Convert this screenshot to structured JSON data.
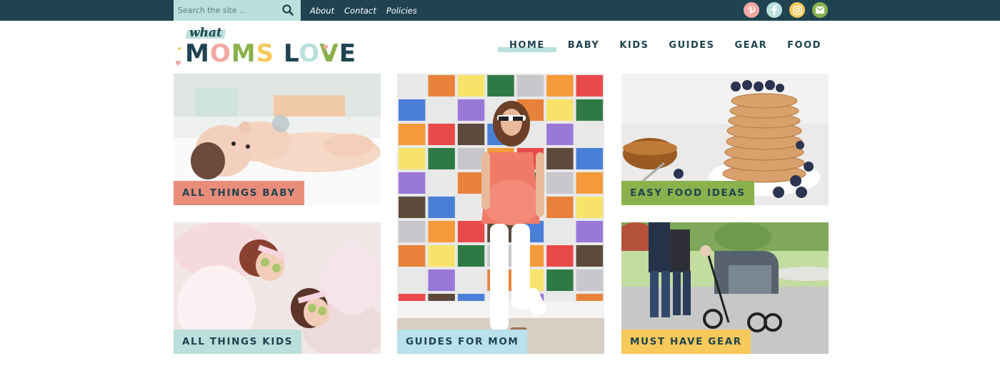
{
  "topbar": {
    "search_placeholder": "Search the site ...",
    "links": [
      "About",
      "Contact",
      "Policies"
    ],
    "social": [
      {
        "name": "pinterest-icon",
        "color": "#f2a7a0"
      },
      {
        "name": "facebook-icon",
        "color": "#b9e0db"
      },
      {
        "name": "instagram-icon",
        "color": "#f7c95a"
      },
      {
        "name": "email-icon",
        "color": "#8bb14c"
      }
    ]
  },
  "logo": {
    "top_word": "what",
    "letters": [
      {
        "ch": "M",
        "color": "#1f4350"
      },
      {
        "ch": "O",
        "color": "#f2a7a0"
      },
      {
        "ch": "M",
        "color": "#8bb14c"
      },
      {
        "ch": "S",
        "color": "#f7c95a"
      },
      {
        "ch": " ",
        "color": "#1f4350"
      },
      {
        "ch": "L",
        "color": "#1f4350"
      },
      {
        "ch": "O",
        "color": "#b9e0db"
      },
      {
        "ch": "V",
        "color": "#8bb14c"
      },
      {
        "ch": "E",
        "color": "#1f4350"
      }
    ]
  },
  "nav": {
    "items": [
      "HOME",
      "BABY",
      "KIDS",
      "GUIDES",
      "GEAR",
      "FOOD"
    ],
    "active": "HOME"
  },
  "tiles": {
    "baby": {
      "label": "ALL THINGS BABY",
      "color": "#e98c7a"
    },
    "guides": {
      "label": "GUIDES FOR MOM",
      "color": "#b9e0eb"
    },
    "food": {
      "label": "EASY FOOD IDEAS",
      "color": "#8bb14c"
    },
    "kids": {
      "label": "ALL THINGS KIDS",
      "color": "#b9e0db"
    },
    "gear": {
      "label": "MUST HAVE GEAR",
      "color": "#f7c95a"
    }
  },
  "colors": {
    "dark": "#1f4350",
    "mint": "#b9e0db"
  }
}
